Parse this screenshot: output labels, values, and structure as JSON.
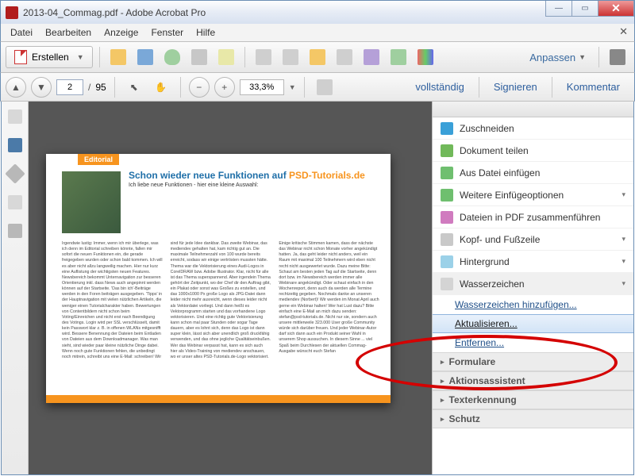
{
  "window": {
    "title": "2013-04_Commag.pdf - Adobe Acrobat Pro",
    "app_icon_label": "PDF"
  },
  "menu": {
    "items": [
      "Datei",
      "Bearbeiten",
      "Anzeige",
      "Fenster",
      "Hilfe"
    ]
  },
  "toolbar": {
    "create_label": "Erstellen",
    "customize_label": "Anpassen"
  },
  "nav": {
    "page_current": "2",
    "page_total": "95",
    "zoom": "33,3%",
    "right_links": [
      "vollständig",
      "Signieren",
      "Kommentar"
    ]
  },
  "document": {
    "tab": "Editorial",
    "headline_a": "Schon wieder neue Funktionen auf ",
    "headline_b": "PSD-Tutorials.de",
    "subhead": "Ich liebe neue Funktionen - hier eine kleine Auswahl:",
    "body": "Irgendwie lustig: Immer, wenn ich mir überlege, was ich denn im Editorial schreiben könnte, fallen mir sofort die neuen Funktionen ein, die gerade freigegeben wurden oder schon bald kommen. Ich will es aber nicht allzu langweilig machen. Hier nur kurz eine Auflistung der wichtigsten neuen Features. Newsbereich bekommt Unternavigation zur besseren Orientierung inkl. dass News auch angepinnt werden können auf der Startseite. 'Das bin ich'-Beiträge werden in den Foren beiträgen ausgegeben. 'Tipps' in der Hauptnavigation mit vielen nützlichen Artikeln, die weniger einen Tutorialcharakter haben. Bewertungen von Contentbildern nicht schon beim Voting/Einreichen und nicht erst nach Beendigung des Votings. Login wird per SSL verschlüsselt, damit kein Passwort klar z. B. in offenen WLANs mitgesnifft wird. Bessere Benennung der Dateien beim Entladen von Dateien aus dem Downloadmanager. Was man sieht, sind wieder paar kleine nützliche Dinge dabei. Wenn noch gute Funktionen fehlen, die unbedingt noch mitrein, schreibt uns eine E-Mail: schreiben! Wir sind für jede Idee dankbar. Das zweite Webinar, das mediendev gehalten hat, kam richtig gut an. Die maximale Teilnehmerzahl von 100 wurde bereits erreicht, sodass wir einige vertrösten mussten hätte. Thema war die Vektorisierung eines Audi-Logos in CorelDRAW bzw. Adobe Illustrator. Klar, nicht für alle ist das Thema superspannend. Aber irgendein Thema gehört der Zeitpunkt, wo der Chef dir den Auftrag gibt, ein Plakat oder sonst was Großes zu erstellen, und das 1000x1000 Px große Logo als JPG-Datei dann leider nicht mehr ausreicht, wenn dieses leider nicht als Vektordatei vorliegt. Und dann heißt es Vektorprogramm starten und das vorhandene Logo vektorisieren. Und eine richtig gute Vektorisierung kann schon mal paar Stunden oder sogar Tage dauern, aber es lohnt sich, denn das Logo ist dann super klein, lässt sich aber unendlich groß druckfähig verwenden, und das ohne jegliche Qualitätseinbußen. Wer das Webinar verpasst hat, kann es sich auch hier als Video-Training von mediendev anschauen, wo er unser altes PSD-Tutorials.de-Logo vektorisiert. Einige kritische Stimmen kamen, dass der nächste das Webinar nicht schon Monate vorher angekündigt hatten. Ja, das geht leider nicht anders, weil ein Raum mit maximal 100 Teilnehmern wird eben nicht recht nicht ausgewertet wurde. Dazu meine Bitte: Schaut am besten jeden Tag auf die Startseite, denn dort bzw. im Newsbereich werden immer alle Webinare angekündigt. Oder schaut einfach in den Wochenreport, denn auch da werden alle Termine rechtzeitig gegeben. Nochmals danke an unseren mediendev (Norbert)! Wir werden im Monat April auch gerne ein Webinar halten! Wer hat Lust dazu? Bitte einfach eine E-Mail an mich dazu senden: stefan@psd-tutorials.de. Nicht nur sie, sondern auch unsere mittlerweile 323.000 User große Community würde sich darüber freuen. Und jeder Webinar-Autor darf sich dann auch ein Produkt seiner Wahl in unserem Shop aussuchen. In diesem Sinne ... viel Spaß beim Durchlesen der aktuellen Commag-Ausgabe wünscht euch Stefan"
  },
  "right_panel": {
    "items_top": [
      {
        "label": "Zuschneiden",
        "icon": "#3aa0d8"
      },
      {
        "label": "Dokument teilen",
        "icon": "#71b95a"
      },
      {
        "label": "Aus Datei einfügen",
        "icon": "#6fbf6f"
      },
      {
        "label": "Weitere Einfügeoptionen",
        "icon": "#6fbf6f",
        "chev": true
      },
      {
        "label": "Dateien in PDF zusammenführen",
        "icon": "#d07bbf"
      },
      {
        "label": "Kopf- und Fußzeile",
        "icon": "#c9c9c9",
        "chev": true
      },
      {
        "label": "Hintergrund",
        "icon": "#9bd1e8",
        "chev": true
      }
    ],
    "watermark": {
      "label": "Wasserzeichen",
      "subitems": [
        "Wasserzeichen hinzufügen...",
        "Aktualisieren...",
        "Entfernen..."
      ]
    },
    "sections": [
      "Formulare",
      "Aktionsassistent",
      "Texterkennung",
      "Schutz"
    ]
  }
}
